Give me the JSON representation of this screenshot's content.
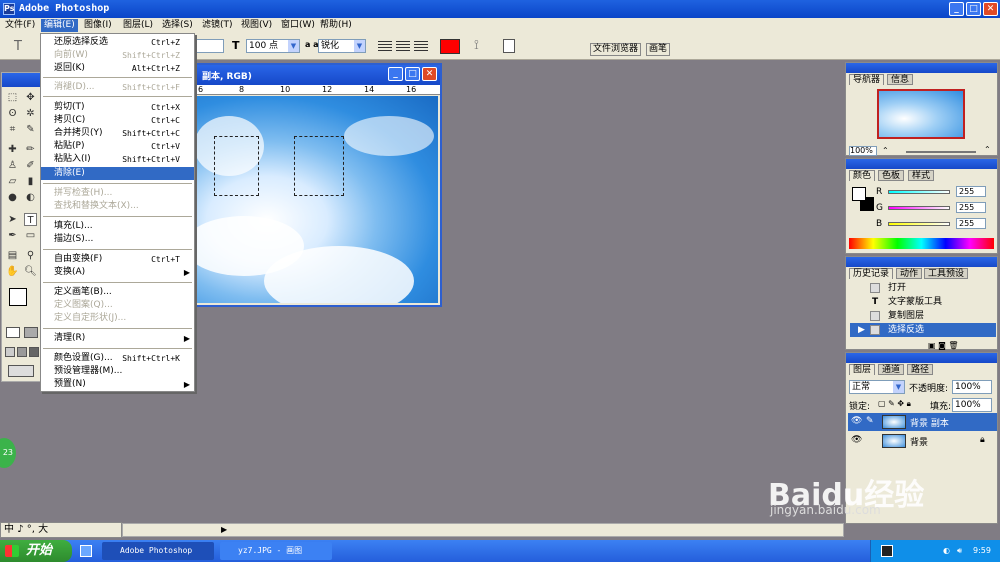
{
  "window": {
    "title": "Adobe Photoshop",
    "icon": "ps-icon"
  },
  "menubar": {
    "items": [
      "文件(F)",
      "编辑(E)",
      "图像(I)",
      "图层(L)",
      "选择(S)",
      "滤镜(T)",
      "视图(V)",
      "窗口(W)",
      "帮助(H)"
    ],
    "active": "编辑(E)"
  },
  "options": {
    "font_size": "100 点",
    "aa_prefix": "a a",
    "antialias": "锐化",
    "color": "#ff0000",
    "tab_browser": "文件浏览器",
    "tab_brush": "画笔"
  },
  "document": {
    "title_suffix": "副本, RGB)",
    "ruler_ticks": [
      "6",
      "8",
      "10",
      "12",
      "14",
      "16"
    ]
  },
  "edit_menu": {
    "items": [
      {
        "label": "还原选择反选",
        "shortcut": "Ctrl+Z",
        "state": "normal"
      },
      {
        "label": "向前(W)",
        "shortcut": "Shift+Ctrl+Z",
        "state": "disabled"
      },
      {
        "label": "返回(K)",
        "shortcut": "Alt+Ctrl+Z",
        "state": "normal"
      },
      {
        "label": "消褪(D)...",
        "shortcut": "Shift+Ctrl+F",
        "state": "disabled"
      },
      {
        "label": "剪切(T)",
        "shortcut": "Ctrl+X",
        "state": "normal"
      },
      {
        "label": "拷贝(C)",
        "shortcut": "Ctrl+C",
        "state": "normal"
      },
      {
        "label": "合并拷贝(Y)",
        "shortcut": "Shift+Ctrl+C",
        "state": "normal"
      },
      {
        "label": "粘贴(P)",
        "shortcut": "Ctrl+V",
        "state": "normal"
      },
      {
        "label": "粘贴入(I)",
        "shortcut": "Shift+Ctrl+V",
        "state": "normal"
      },
      {
        "label": "清除(E)",
        "shortcut": "",
        "state": "highlighted"
      },
      {
        "label": "拼写检查(H)...",
        "shortcut": "",
        "state": "disabled"
      },
      {
        "label": "查找和替换文本(X)...",
        "shortcut": "",
        "state": "disabled"
      },
      {
        "label": "填充(L)...",
        "shortcut": "",
        "state": "normal"
      },
      {
        "label": "描边(S)...",
        "shortcut": "",
        "state": "normal"
      },
      {
        "label": "自由变换(F)",
        "shortcut": "Ctrl+T",
        "state": "normal"
      },
      {
        "label": "变换(A)",
        "shortcut": "",
        "state": "submenu"
      },
      {
        "label": "定义画笔(B)...",
        "shortcut": "",
        "state": "normal"
      },
      {
        "label": "定义图案(Q)...",
        "shortcut": "",
        "state": "disabled"
      },
      {
        "label": "定义自定形状(J)...",
        "shortcut": "",
        "state": "disabled"
      },
      {
        "label": "清理(R)",
        "shortcut": "",
        "state": "submenu"
      },
      {
        "label": "颜色设置(G)...",
        "shortcut": "Shift+Ctrl+K",
        "state": "normal"
      },
      {
        "label": "预设管理器(M)...",
        "shortcut": "",
        "state": "normal"
      },
      {
        "label": "预置(N)",
        "shortcut": "",
        "state": "submenu"
      }
    ]
  },
  "navigator": {
    "tabs": [
      "导航器",
      "信息"
    ],
    "zoom": "100%"
  },
  "color_panel": {
    "tabs": [
      "颜色",
      "色板",
      "样式"
    ],
    "channels": [
      {
        "name": "R",
        "value": "255"
      },
      {
        "name": "G",
        "value": "255"
      },
      {
        "name": "B",
        "value": "255"
      }
    ]
  },
  "history_panel": {
    "tabs": [
      "历史记录",
      "动作",
      "工具预设"
    ],
    "items": [
      {
        "label": "打开",
        "active": false
      },
      {
        "label": "文字蒙版工具",
        "active": false
      },
      {
        "label": "复制图层",
        "active": false
      },
      {
        "label": "选择反选",
        "active": true
      }
    ]
  },
  "layers_panel": {
    "tabs": [
      "图层",
      "通道",
      "路径"
    ],
    "blend_mode": "正常",
    "opacity_label": "不透明度:",
    "opacity": "100%",
    "lock_label": "锁定:",
    "fill_label": "填充:",
    "fill": "100%",
    "layers": [
      {
        "name": "背景 副本",
        "active": true
      },
      {
        "name": "背景",
        "active": false
      }
    ]
  },
  "ime": {
    "text": "中 ♪ °, 大"
  },
  "taskbar": {
    "start": "开始",
    "tasks": [
      "Adobe Photoshop",
      "yz7.JPG - 画图"
    ],
    "time": "9:59"
  },
  "watermark": {
    "brand": "Baidu",
    "cn": "经验",
    "url": "jingyan.baidu.com"
  },
  "badge": "23"
}
